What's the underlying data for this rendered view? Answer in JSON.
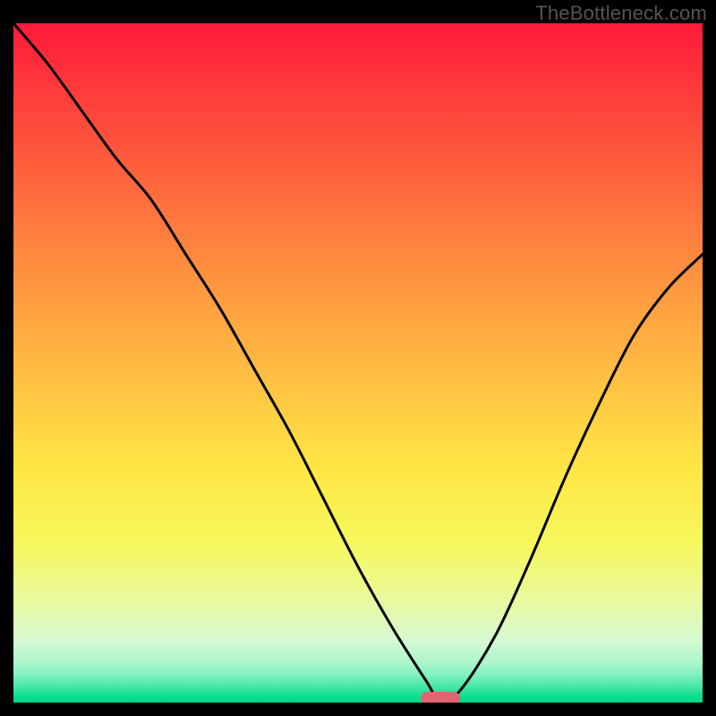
{
  "watermark": "TheBottleneck.com",
  "chart_data": {
    "type": "line",
    "title": "",
    "xlabel": "",
    "ylabel": "",
    "xlim": [
      0,
      100
    ],
    "ylim": [
      0,
      100
    ],
    "background_gradient": {
      "top": "#fe1a3a",
      "bottom": "#00d886"
    },
    "series": [
      {
        "name": "bottleneck-curve",
        "color": "#000000",
        "x": [
          0,
          5,
          10,
          15,
          20,
          25,
          30,
          35,
          40,
          45,
          50,
          55,
          60,
          62,
          65,
          70,
          75,
          80,
          85,
          90,
          95,
          100
        ],
        "y": [
          100,
          94,
          87,
          80,
          74,
          66,
          58,
          49,
          40,
          30,
          20,
          11,
          3,
          0,
          2,
          10,
          21,
          33,
          44,
          54,
          61,
          66
        ]
      }
    ],
    "marker": {
      "x": 62,
      "y": 0,
      "color": "#e16471",
      "shape": "pill"
    }
  }
}
